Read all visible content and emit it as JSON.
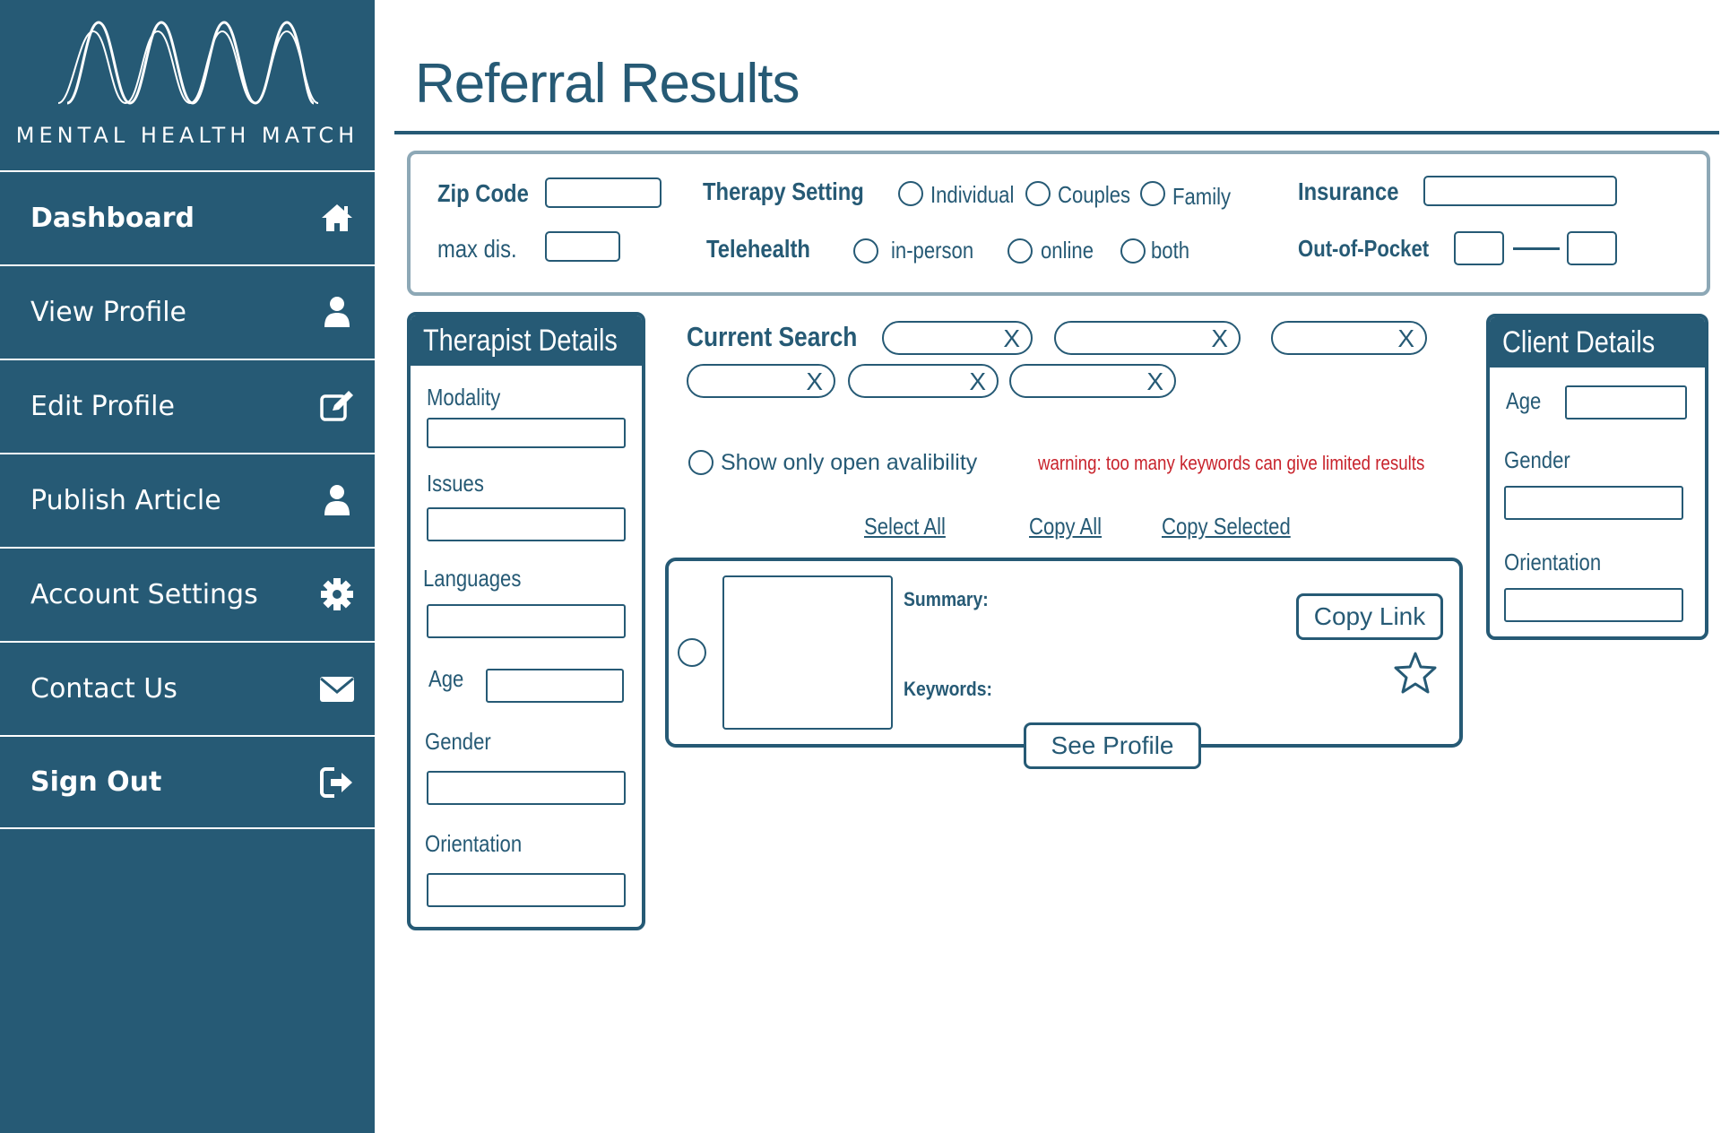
{
  "brand": {
    "name": "MENTAL HEALTH MATCH"
  },
  "sidebar": {
    "items": [
      {
        "label": "Dashboard",
        "icon": "home-icon"
      },
      {
        "label": "View Profile",
        "icon": "user-icon"
      },
      {
        "label": "Edit Profile",
        "icon": "edit-icon"
      },
      {
        "label": "Publish Article",
        "icon": "user-icon"
      },
      {
        "label": "Account Settings",
        "icon": "gear-icon"
      },
      {
        "label": "Contact Us",
        "icon": "envelope-icon"
      },
      {
        "label": "Sign Out",
        "icon": "sign-out-icon"
      }
    ]
  },
  "page": {
    "title": "Referral Results"
  },
  "filters": {
    "zip_label": "Zip Code",
    "max_dis_label": "max dis.",
    "therapy_setting_label": "Therapy Setting",
    "therapy_options": [
      "Individual",
      "Couples",
      "Family"
    ],
    "telehealth_label": "Telehealth",
    "telehealth_options": [
      "in-person",
      "online",
      "both"
    ],
    "insurance_label": "Insurance",
    "out_of_pocket_label": "Out-of-Pocket"
  },
  "therapist_details": {
    "title": "Therapist Details",
    "modality": "Modality",
    "issues": "Issues",
    "languages": "Languages",
    "age": "Age",
    "gender": "Gender",
    "orientation": "Orientation"
  },
  "current_search": {
    "title": "Current Search",
    "chip_close": "X",
    "availability_label": "Show only open avalibility",
    "warning": "warning: too many keywords can give limited results",
    "select_all": "Select All",
    "copy_all": "Copy All",
    "copy_selected": "Copy Selected"
  },
  "result": {
    "summary_label": "Summary:",
    "keywords_label": "Keywords:",
    "copy_link": "Copy Link",
    "see_profile": "See Profile"
  },
  "client_details": {
    "title": "Client Details",
    "age": "Age",
    "gender": "Gender",
    "orientation": "Orientation"
  },
  "colors": {
    "primary": "#265a75",
    "border_light": "#8da8b6",
    "warning": "#c8232c"
  }
}
